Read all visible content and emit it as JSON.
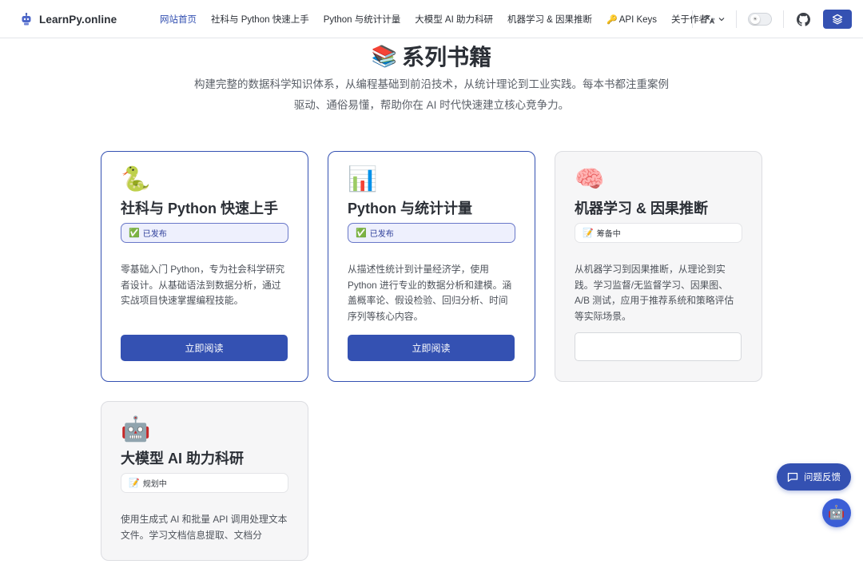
{
  "brand": {
    "name": "LearnPy.online",
    "icon": "robot-logo-icon"
  },
  "nav": {
    "links": [
      {
        "label": "网站首页",
        "active": true
      },
      {
        "label": "社科与 Python 快速上手",
        "active": false
      },
      {
        "label": "Python 与统计计量",
        "active": false
      },
      {
        "label": "大模型 AI 助力科研",
        "active": false
      },
      {
        "label": "机器学习 & 因果推断",
        "active": false
      },
      {
        "label": "API Keys",
        "icon": "key-icon",
        "active": false
      },
      {
        "label": "关于作者",
        "external": true,
        "active": false
      }
    ],
    "key_glyph": "🔑",
    "external_glyph": "↗",
    "language_icon": "translate-icon",
    "theme_toggle_icon": "sun-icon",
    "github_icon": "github-icon",
    "layers_icon": "layers-icon"
  },
  "header": {
    "emoji": "📚",
    "title": "系列书籍",
    "subtitle": "构建完整的数据科学知识体系，从编程基础到前沿技术，从统计理论到工业实践。每本书都注重案例驱动、通俗易懂，帮助你在 AI 时代快速建立核心竞争力。"
  },
  "books": [
    {
      "emoji": "🐍",
      "title": "社科与 Python 快速上手",
      "status": "published",
      "badge_icon": "✅",
      "badge": "已发布",
      "description": "零基础入门 Python，专为社会科学研究者设计。从基础语法到数据分析，通过实战项目快速掌握编程技能。",
      "button": "立即阅读"
    },
    {
      "emoji": "📊",
      "title": "Python 与统计计量",
      "status": "published",
      "badge_icon": "✅",
      "badge": "已发布",
      "description": "从描述性统计到计量经济学，使用 Python 进行专业的数据分析和建模。涵盖概率论、假设检验、回归分析、时间序列等核心内容。",
      "button": "立即阅读"
    },
    {
      "emoji": "🧠",
      "title": "机器学习 & 因果推断",
      "status": "preparing",
      "badge_icon": "📝",
      "badge": "筹备中",
      "description": "从机器学习到因果推断，从理论到实践。学习监督/无监督学习、因果图、A/B 测试，应用于推荐系统和策略评估等实际场景。",
      "button": ""
    },
    {
      "emoji": "🤖",
      "title": "大模型 AI 助力科研",
      "status": "planned",
      "badge_icon": "📝",
      "badge": "规划中",
      "description": "使用生成式 AI 和批量 API 调用处理文本文件。学习文档信息提取、文档分",
      "button": ""
    }
  ],
  "floating": {
    "feedback_label": "问题反馈",
    "feedback_icon": "chat-icon",
    "assistant_icon": "robot-assistant-icon",
    "assistant_glyph": "🤖"
  },
  "colors": {
    "accent": "#3451b2",
    "badge_bg": "#eef0fd",
    "planned_card_bg": "#f6f6f7"
  }
}
